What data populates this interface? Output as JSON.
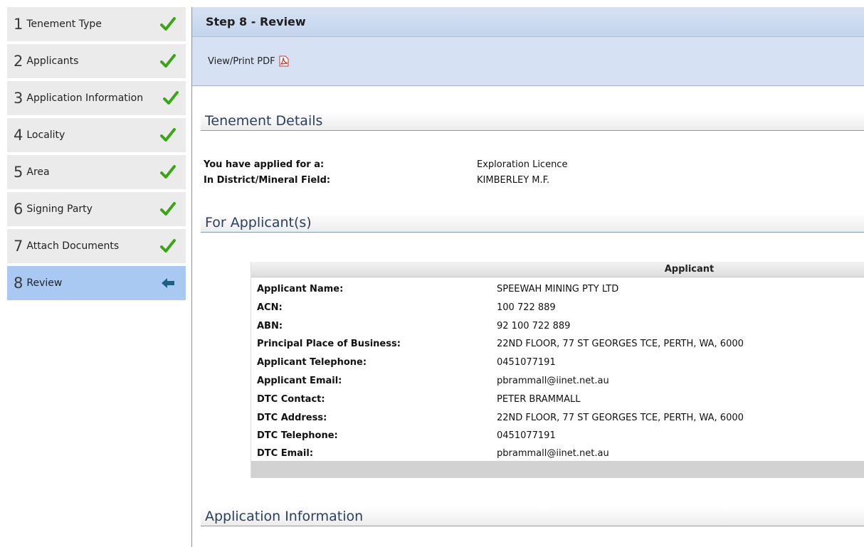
{
  "sidebar": {
    "steps": [
      {
        "num": "1",
        "label": "Tenement Type",
        "status": "complete"
      },
      {
        "num": "2",
        "label": "Applicants",
        "status": "complete"
      },
      {
        "num": "3",
        "label": "Application Information",
        "status": "complete"
      },
      {
        "num": "4",
        "label": "Locality",
        "status": "complete"
      },
      {
        "num": "5",
        "label": "Area",
        "status": "complete"
      },
      {
        "num": "6",
        "label": "Signing Party",
        "status": "complete"
      },
      {
        "num": "7",
        "label": "Attach Documents",
        "status": "complete"
      },
      {
        "num": "8",
        "label": "Review",
        "status": "current"
      }
    ],
    "icons": {
      "complete": "checkmark-icon",
      "current": "arrow-left-icon"
    },
    "colors": {
      "check": "#3aa615",
      "arrow": "#1f5f86",
      "active_bg": "#a9c9f2"
    }
  },
  "main": {
    "step_title": "Step 8 - Review",
    "pdf_link": "View/Print PDF",
    "pdf_icon": "pdf-icon",
    "sections": {
      "tenement_details": "Tenement Details",
      "applicants": "For Applicant(s)",
      "application_information": "Application Information"
    },
    "tenement": {
      "applied_for_label": "You have applied for a:",
      "applied_for_value": "Exploration Licence",
      "district_label": "In District/Mineral Field:",
      "district_value": "KIMBERLEY M.F."
    },
    "applicant": {
      "header": "Applicant",
      "rows": [
        {
          "label": "Applicant Name:",
          "value": "SPEEWAH MINING PTY LTD"
        },
        {
          "label": "ACN:",
          "value": "100 722 889"
        },
        {
          "label": "ABN:",
          "value": "92 100 722 889"
        },
        {
          "label": "Principal Place of Business:",
          "value": "22ND FLOOR, 77 ST GEORGES TCE, PERTH, WA, 6000"
        },
        {
          "label": "Applicant Telephone:",
          "value": "0451077191"
        },
        {
          "label": "Applicant Email:",
          "value": "pbrammall@iinet.net.au"
        },
        {
          "label": "DTC Contact:",
          "value": "PETER BRAMMALL"
        },
        {
          "label": "DTC Address:",
          "value": "22ND FLOOR, 77 ST GEORGES TCE, PERTH, WA, 6000"
        },
        {
          "label": "DTC Telephone:",
          "value": "0451077191"
        },
        {
          "label": "DTC Email:",
          "value": "pbrammall@iinet.net.au"
        }
      ]
    }
  }
}
